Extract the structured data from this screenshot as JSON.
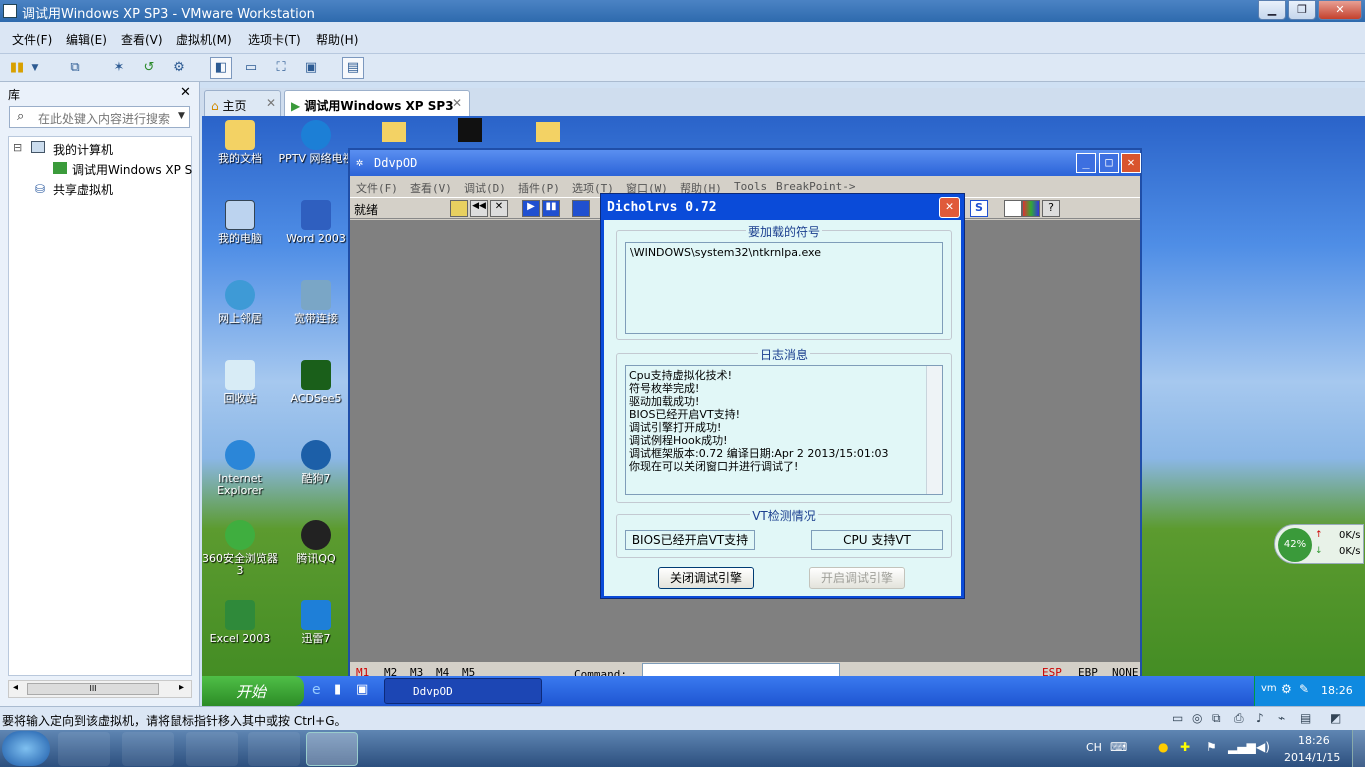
{
  "window": {
    "title": "调试用Windows XP SP3 - VMware Workstation",
    "minimize": "▁",
    "maximize": "❐",
    "close": "✕"
  },
  "menu": [
    "文件(F)",
    "编辑(E)",
    "查看(V)",
    "虚拟机(M)",
    "选项卡(T)",
    "帮助(H)"
  ],
  "library": {
    "title": "库",
    "close": "✕",
    "search_placeholder": "在此处键入内容进行搜索",
    "tree": [
      "我的计算机",
      "调试用Windows XP S",
      "共享虚拟机"
    ],
    "tree_toggle": "⊟",
    "scroll_thumb": "III",
    "scroll_left": "◂",
    "scroll_right": "▸"
  },
  "tabs": [
    {
      "label": "主页",
      "close": "✕"
    },
    {
      "label": "调试用Windows XP SP3",
      "close": "✕"
    }
  ],
  "desktop_icons": [
    {
      "label": "我的文档",
      "icon": "folder-icon"
    },
    {
      "label": "PPTV 网络电视",
      "icon": "pptv-icon"
    },
    {
      "label": "我的电脑",
      "icon": "computer-icon"
    },
    {
      "label": "Word 2003",
      "icon": "word-icon"
    },
    {
      "label": "网上邻居",
      "icon": "network-icon"
    },
    {
      "label": "宽带连接",
      "icon": "broadband-icon"
    },
    {
      "label": "回收站",
      "icon": "recycle-bin-icon"
    },
    {
      "label": "ACDSee5",
      "icon": "acdsee-icon"
    },
    {
      "label": "Internet Explorer",
      "icon": "ie-icon"
    },
    {
      "label": "酷狗7",
      "icon": "kugou-icon"
    },
    {
      "label": "360安全浏览器 3",
      "icon": "360-browser-icon"
    },
    {
      "label": "腾讯QQ",
      "icon": "qq-icon"
    },
    {
      "label": "Excel 2003",
      "icon": "excel-icon"
    },
    {
      "label": "迅雷7",
      "icon": "xunlei-icon"
    }
  ],
  "olly": {
    "title": "DdvpOD",
    "menu": [
      "文件(F)",
      "查看(V)",
      "调试(D)",
      "插件(P)",
      "选项(T)",
      "窗口(W)",
      "帮助(H)",
      "Tools",
      "BreakPoint->"
    ],
    "status_left": "就绪",
    "bottom": {
      "tabs": [
        "M1",
        "M2",
        "M3",
        "M4",
        "M5"
      ],
      "command_label": "Command:",
      "regs": [
        "ESP",
        "EBP",
        "NONE"
      ]
    }
  },
  "dialog": {
    "title": "Dicholrvs 0.72",
    "close": "✕",
    "symbols_group": "要加载的符号",
    "symbols_path": "\\WINDOWS\\system32\\ntkrnlpa.exe",
    "log_group": "日志消息",
    "log_lines": [
      "Cpu支持虚拟化技术!",
      "符号枚举完成!",
      "驱动加载成功!",
      "BIOS已经开启VT支持!",
      "调试引擎打开成功!",
      "调试例程Hook成功!",
      "调试框架版本:0.72 编译日期:Apr  2 2013/15:01:03",
      "你现在可以关闭窗口并进行调试了!"
    ],
    "vt_group": "VT检测情况",
    "bios_status": "BIOS已经开启VT支持",
    "cpu_status": "CPU 支持VT",
    "close_engine_button": "关闭调试引擎",
    "open_engine_button": "开启调试引擎"
  },
  "xp_taskbar": {
    "start": "开始",
    "task": "DdvpOD",
    "clock": "18:26"
  },
  "net_widget": {
    "percent": "42%",
    "up": "0K/s",
    "down": "0K/s"
  },
  "status_hint": "要将输入定向到该虚拟机，请将鼠标指针移入其中或按 Ctrl+G。",
  "win7": {
    "lang": "CH",
    "time": "18:26",
    "date": "2014/1/15"
  }
}
